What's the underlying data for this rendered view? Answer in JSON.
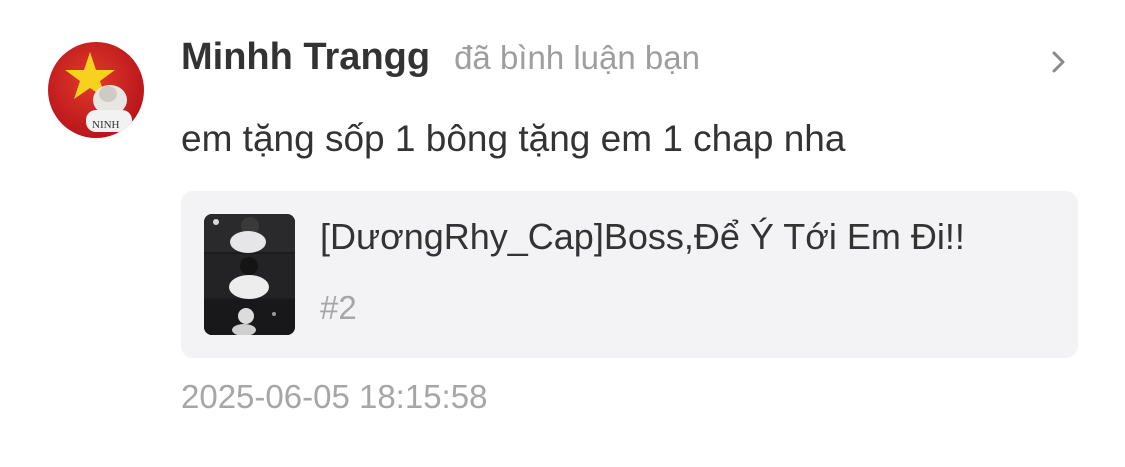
{
  "notification": {
    "avatar_icon": "user-avatar-vietnam-flag",
    "avatar_caption": "NINH",
    "username": "Minhh Trangg",
    "action_text": "đã bình luận bạn",
    "chevron_icon": "chevron-right-icon",
    "comment": "em tặng sốp 1 bông tặng em 1 chap nha",
    "work": {
      "title": "[DươngRhy_Cap]Boss,Để Ý Tới Em Đi!!",
      "chapter": "#2",
      "cover_icon": "comic-cover-thumbnail"
    },
    "timestamp": "2025-06-05 18:15:58"
  },
  "colors": {
    "primary_text": "#333333",
    "secondary_text": "#a6a6a6",
    "card_background": "#f3f3f5",
    "avatar_red": "#d71e1e",
    "star_yellow": "#f6d21e"
  }
}
